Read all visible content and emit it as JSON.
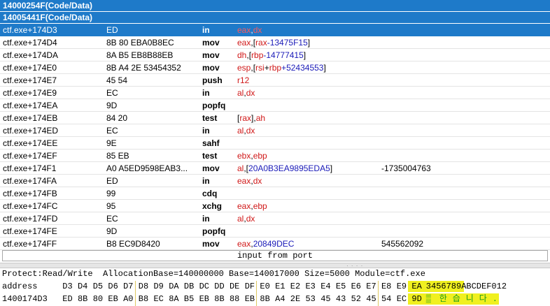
{
  "disasm": {
    "headers": [
      "14000254F(Code/Data)",
      "14005441F(Code/Data)"
    ],
    "rows": [
      {
        "addr": "ctf.exe+174D3",
        "bytes": "ED",
        "mn": "in",
        "ops": [
          [
            "reg",
            "eax"
          ],
          [
            "p",
            ","
          ],
          [
            "reg",
            "dx"
          ]
        ],
        "cm": "",
        "selected": true
      },
      {
        "addr": "ctf.exe+174D4",
        "bytes": "8B 80 EBA0B8EC",
        "mn": "mov",
        "ops": [
          [
            "reg",
            "eax"
          ],
          [
            "p",
            ",["
          ],
          [
            "reg",
            "rax"
          ],
          [
            "num",
            "-13475F15"
          ],
          [
            "p",
            "]"
          ]
        ],
        "cm": ""
      },
      {
        "addr": "ctf.exe+174DA",
        "bytes": "8A B5 EB8B88EB",
        "mn": "mov",
        "ops": [
          [
            "reg",
            "dh"
          ],
          [
            "p",
            ",["
          ],
          [
            "reg",
            "rbp"
          ],
          [
            "num",
            "-14777415"
          ],
          [
            "p",
            "]"
          ]
        ],
        "cm": ""
      },
      {
        "addr": "ctf.exe+174E0",
        "bytes": "8B A4 2E 53454352",
        "mn": "mov",
        "ops": [
          [
            "reg",
            "esp"
          ],
          [
            "p",
            ",["
          ],
          [
            "reg",
            "rsi"
          ],
          [
            "p",
            "+"
          ],
          [
            "reg",
            "rbp"
          ],
          [
            "num",
            "+52434553"
          ],
          [
            "p",
            "]"
          ]
        ],
        "cm": ""
      },
      {
        "addr": "ctf.exe+174E7",
        "bytes": "45 54",
        "mn": "push",
        "ops": [
          [
            "reg",
            "r12"
          ]
        ],
        "cm": ""
      },
      {
        "addr": "ctf.exe+174E9",
        "bytes": "EC",
        "mn": "in",
        "ops": [
          [
            "reg",
            "al"
          ],
          [
            "p",
            ","
          ],
          [
            "reg",
            "dx"
          ]
        ],
        "cm": ""
      },
      {
        "addr": "ctf.exe+174EA",
        "bytes": "9D",
        "mn": "popfq",
        "ops": [],
        "cm": ""
      },
      {
        "addr": "ctf.exe+174EB",
        "bytes": "84 20",
        "mn": "test",
        "ops": [
          [
            "p",
            "["
          ],
          [
            "reg",
            "rax"
          ],
          [
            "p",
            "],"
          ],
          [
            "reg",
            "ah"
          ]
        ],
        "cm": ""
      },
      {
        "addr": "ctf.exe+174ED",
        "bytes": "EC",
        "mn": "in",
        "ops": [
          [
            "reg",
            "al"
          ],
          [
            "p",
            ","
          ],
          [
            "reg",
            "dx"
          ]
        ],
        "cm": ""
      },
      {
        "addr": "ctf.exe+174EE",
        "bytes": "9E",
        "mn": "sahf",
        "ops": [],
        "cm": ""
      },
      {
        "addr": "ctf.exe+174EF",
        "bytes": "85 EB",
        "mn": "test",
        "ops": [
          [
            "reg",
            "ebx"
          ],
          [
            "p",
            ","
          ],
          [
            "reg",
            "ebp"
          ]
        ],
        "cm": ""
      },
      {
        "addr": "ctf.exe+174F1",
        "bytes": "A0 A5ED9598EAB3...",
        "mn": "mov",
        "ops": [
          [
            "reg",
            "al"
          ],
          [
            "p",
            ",["
          ],
          [
            "num",
            "20A0B3EA9895EDA5"
          ],
          [
            "p",
            "]"
          ]
        ],
        "cm": "-1735004763"
      },
      {
        "addr": "ctf.exe+174FA",
        "bytes": "ED",
        "mn": "in",
        "ops": [
          [
            "reg",
            "eax"
          ],
          [
            "p",
            ","
          ],
          [
            "reg",
            "dx"
          ]
        ],
        "cm": ""
      },
      {
        "addr": "ctf.exe+174FB",
        "bytes": "99",
        "mn": "cdq",
        "ops": [],
        "cm": ""
      },
      {
        "addr": "ctf.exe+174FC",
        "bytes": "95",
        "mn": "xchg",
        "ops": [
          [
            "reg",
            "eax"
          ],
          [
            "p",
            ","
          ],
          [
            "reg",
            "ebp"
          ]
        ],
        "cm": ""
      },
      {
        "addr": "ctf.exe+174FD",
        "bytes": "EC",
        "mn": "in",
        "ops": [
          [
            "reg",
            "al"
          ],
          [
            "p",
            ","
          ],
          [
            "reg",
            "dx"
          ]
        ],
        "cm": ""
      },
      {
        "addr": "ctf.exe+174FE",
        "bytes": "9D",
        "mn": "popfq",
        "ops": [],
        "cm": ""
      },
      {
        "addr": "ctf.exe+174FF",
        "bytes": "B8 EC9D8420",
        "mn": "mov",
        "ops": [
          [
            "reg",
            "eax"
          ],
          [
            "p",
            ","
          ],
          [
            "num",
            "20849DEC"
          ]
        ],
        "cm": "545562092"
      }
    ]
  },
  "status": {
    "text": "input from port"
  },
  "hex": {
    "info": "Protect:Read/Write  AllocationBase=140000000 Base=140017000 Size=5000 Module=ctf.exe",
    "col_label": "address",
    "cols": [
      "D3",
      "D4",
      "D5",
      "D6",
      "D7",
      "D8",
      "D9",
      "DA",
      "DB",
      "DC",
      "DD",
      "DE",
      "DF",
      "E0",
      "E1",
      "E2",
      "E3",
      "E4",
      "E5",
      "E6",
      "E7",
      "E8",
      "E9",
      "EA"
    ],
    "ascii_header": "3456789ABCDEF012",
    "row_addr": "1400174D3",
    "bytes": [
      "ED",
      "8B",
      "80",
      "EB",
      "A0",
      "B8",
      "EC",
      "8A",
      "B5",
      "EB",
      "8B",
      "88",
      "EB",
      "8B",
      "A4",
      "2E",
      "53",
      "45",
      "43",
      "52",
      "45",
      "54",
      "EC",
      "9D"
    ],
    "ascii": [
      "▒",
      "한",
      "습",
      "니",
      "다",
      "."
    ],
    "colors": {
      "selected_bg": "#1e7ac9",
      "register": "#d01818",
      "number": "#1a1ab8",
      "hex_bytes": "#1a9a1a",
      "highlight": "#f0f020"
    }
  }
}
